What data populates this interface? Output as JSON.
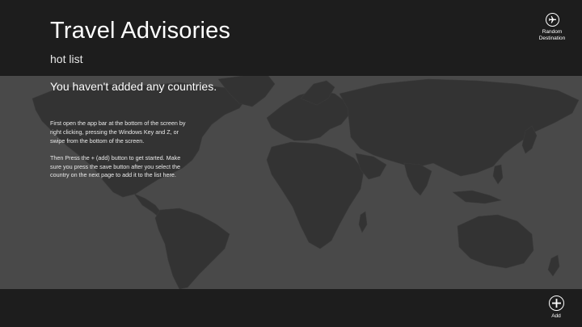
{
  "header": {
    "title": "Travel Advisories",
    "subtitle": "hot list"
  },
  "message": {
    "heading": "You haven't added any countries.",
    "paragraph1": "First open the app bar at the bottom of the screen by right clicking, pressing the Windows Key and Z, or swipe from the bottom of the screen.",
    "paragraph2": "Then Press the + (add) button to get started. Make sure you press the save button after you select the country on the next page to add it to the list here."
  },
  "top_bar": {
    "random_label_line1": "Random",
    "random_label_line2": "Destination",
    "random_icon": "airplane-icon"
  },
  "bottom_bar": {
    "add_label": "Add",
    "add_icon": "plus-icon"
  },
  "colors": {
    "chrome_background": "#1d1d1d",
    "map_background": "#494949",
    "land": "#333333"
  }
}
